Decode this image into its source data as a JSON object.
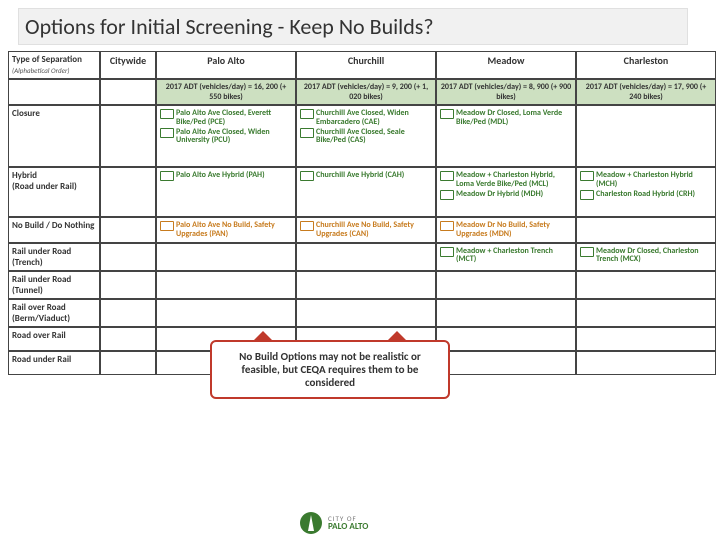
{
  "title": "Options for Initial Screening - Keep No Builds?",
  "cols": {
    "c0": "Type of Separation",
    "c0sub": "(Alphabetical Order)",
    "c1": "Citywide",
    "c2": "Palo Alto",
    "c3": "Churchill",
    "c4": "Meadow",
    "c5": "Charleston"
  },
  "adt": {
    "c2": "2017 ADT (vehicles/day) = 16, 200 (+ 550 bikes)",
    "c3": "2017 ADT (vehicles/day) = 9, 200 (+ 1, 020 bikes)",
    "c4": "2017 ADT (vehicles/day) = 8, 900 (+ 900 bikes)",
    "c5": "2017 ADT (vehicles/day) = 17, 900 (+ 240 bikes)"
  },
  "rows": {
    "closure": "Closure",
    "hybrid": "Hybrid",
    "hybrid_sub": "(Road under Rail)",
    "nobuild": "No Build / Do Nothing",
    "trench": "Rail under Road (Trench)",
    "tunnel": "Rail under Road (Tunnel)",
    "berm": "Rail over Road (Berm/Viaduct)",
    "roadover": "Road over Rail",
    "roadunder": "Road under Rail"
  },
  "closure": {
    "pa1": "Palo Alto Ave Closed, Everett Bike/Ped (PCE)",
    "pa2": "Palo Alto Ave Closed, Widen University (PCU)",
    "ch1": "Churchill Ave Closed, Widen Embarcadero (CAE)",
    "ch2": "Churchill Ave Closed, Seale Bike/Ped (CAS)",
    "md1": "Meadow Dr Closed, Loma Verde Bike/Ped (MDL)"
  },
  "hybrid": {
    "pa": "Palo Alto Ave Hybrid (PAH)",
    "ch": "Churchill Ave Hybrid (CAH)",
    "md1": "Meadow + Charleston Hybrid, Loma Verde Bike/Ped (MCL)",
    "md2": "Meadow Dr Hybrid (MDH)",
    "cs1": "Meadow + Charleston Hybrid (MCH)",
    "cs2": "Charleston Road Hybrid (CRH)"
  },
  "nobuild": {
    "pa": "Palo Alto Ave No Build, Safety Upgrades (PAN)",
    "ch": "Churchill Ave No Build, Safety Upgrades (CAN)",
    "md": "Meadow Dr No Build, Safety Upgrades (MDN)"
  },
  "trench": {
    "md": "Meadow + Charleston Trench (MCT)",
    "cs": "Meadow Dr Closed, Charleston Trench (MCX)"
  },
  "callout": "No Build Options may not be realistic or feasible, but CEQA requires them to be considered",
  "logo": {
    "city": "CITY OF",
    "name": "PALO ALTO"
  },
  "chart_data": {
    "type": "table",
    "title": "Options for Initial Screening - Keep No Builds?",
    "columns": [
      "Type of Separation",
      "Citywide",
      "Palo Alto",
      "Churchill",
      "Meadow",
      "Charleston"
    ],
    "adt_2017": {
      "Palo Alto": {
        "vehicles_per_day": 16200,
        "bikes": 550
      },
      "Churchill": {
        "vehicles_per_day": 9200,
        "bikes": 1020
      },
      "Meadow": {
        "vehicles_per_day": 8900,
        "bikes": 900
      },
      "Charleston": {
        "vehicles_per_day": 17900,
        "bikes": 240
      }
    },
    "rows": [
      {
        "type": "Closure",
        "Palo Alto": [
          "PCE",
          "PCU"
        ],
        "Churchill": [
          "CAE",
          "CAS"
        ],
        "Meadow": [
          "MDL"
        ],
        "Charleston": []
      },
      {
        "type": "Hybrid (Road under Rail)",
        "Palo Alto": [
          "PAH"
        ],
        "Churchill": [
          "CAH"
        ],
        "Meadow": [
          "MCL",
          "MDH"
        ],
        "Charleston": [
          "MCH",
          "CRH"
        ]
      },
      {
        "type": "No Build / Do Nothing",
        "Palo Alto": [
          "PAN"
        ],
        "Churchill": [
          "CAN"
        ],
        "Meadow": [
          "MDN"
        ],
        "Charleston": []
      },
      {
        "type": "Rail under Road (Trench)",
        "Palo Alto": [],
        "Churchill": [],
        "Meadow": [
          "MCT"
        ],
        "Charleston": [
          "MCX"
        ]
      },
      {
        "type": "Rail under Road (Tunnel)"
      },
      {
        "type": "Rail over Road (Berm/Viaduct)"
      },
      {
        "type": "Road over Rail"
      },
      {
        "type": "Road under Rail"
      }
    ]
  }
}
